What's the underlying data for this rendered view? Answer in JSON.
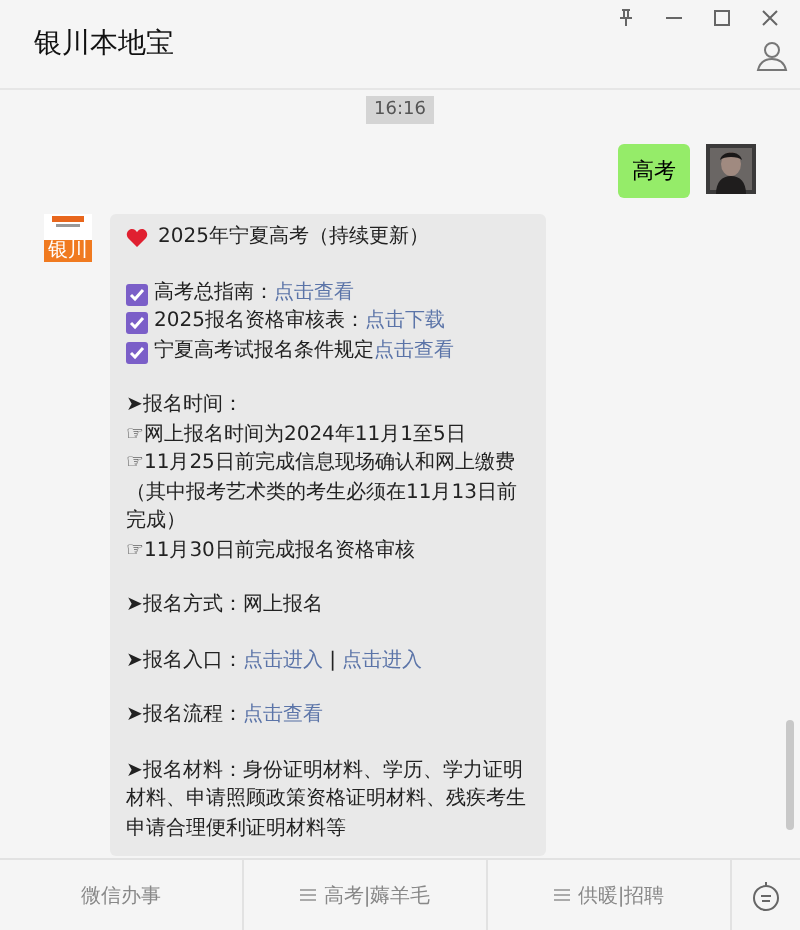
{
  "window": {
    "title": "银川本地宝"
  },
  "time_badge": "16:16",
  "outgoing": {
    "text": "高考"
  },
  "incoming": {
    "sender_badge": "银川",
    "blocks": [
      [
        {
          "kind": "title",
          "parts": [
            {
              "text": "2025年宁夏高考（持续更新）",
              "link": false
            }
          ]
        }
      ],
      [
        {
          "kind": "check",
          "parts": [
            {
              "text": "高考总指南：",
              "link": false
            },
            {
              "text": "点击查看",
              "link": true
            }
          ]
        },
        {
          "kind": "check",
          "parts": [
            {
              "text": "2025报名资格审核表：",
              "link": false
            },
            {
              "text": "点击下载",
              "link": true
            }
          ]
        },
        {
          "kind": "check",
          "parts": [
            {
              "text": "宁夏高考试报名条件规定",
              "link": false
            },
            {
              "text": "点击查看",
              "link": true
            }
          ]
        }
      ],
      [
        {
          "kind": "text",
          "parts": [
            {
              "text": "➤报名时间：",
              "link": false
            }
          ]
        },
        {
          "kind": "text",
          "parts": [
            {
              "text": "☞网上报名时间为2024年11月1至5日",
              "link": false
            }
          ]
        },
        {
          "kind": "text",
          "parts": [
            {
              "text": "☞11月25日前完成信息现场确认和网上缴费（其中报考艺术类的考生必须在11月13日前完成）",
              "link": false
            }
          ]
        },
        {
          "kind": "text",
          "parts": [
            {
              "text": "☞11月30日前完成报名资格审核",
              "link": false
            }
          ]
        }
      ],
      [
        {
          "kind": "text",
          "parts": [
            {
              "text": "➤报名方式：网上报名",
              "link": false
            }
          ]
        }
      ],
      [
        {
          "kind": "text",
          "parts": [
            {
              "text": "➤报名入口：",
              "link": false
            },
            {
              "text": "点击进入",
              "link": true
            },
            {
              "text": " | ",
              "link": false
            },
            {
              "text": "点击进入",
              "link": true
            }
          ]
        }
      ],
      [
        {
          "kind": "text",
          "parts": [
            {
              "text": "➤报名流程：",
              "link": false
            },
            {
              "text": "点击查看",
              "link": true
            }
          ]
        }
      ],
      [
        {
          "kind": "text",
          "parts": [
            {
              "text": "➤报名材料：身份证明材料、学历、学力证明材料、申请照顾政策资格证明材料、残疾考生申请合理便利证明材料等",
              "link": false
            }
          ]
        }
      ]
    ]
  },
  "menu": [
    {
      "label": "微信办事",
      "has_list_icon": false
    },
    {
      "label": "高考|薅羊毛",
      "has_list_icon": true
    },
    {
      "label": "供暖|招聘",
      "has_list_icon": true
    }
  ]
}
